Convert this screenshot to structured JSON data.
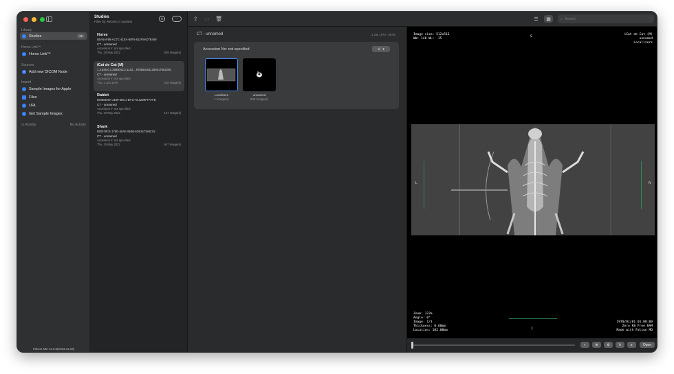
{
  "sidebar": {
    "sections": {
      "library": "Library",
      "horos": "Horos Link™",
      "sources": "Sources",
      "import": "Import"
    },
    "items": {
      "studies": "Studies",
      "studies_count": "16",
      "horos_link": "Horos Link™",
      "add_dicom_node": "Add new DICOM Node",
      "sample_apple": "Sample Images for Apple",
      "files": "Files",
      "url": "URL",
      "get_samples": "Get Sample Images"
    },
    "activity_label": "Activity",
    "activity_status": "No Activity",
    "footer": "Falcon MD v4.0.0(2023.11.23)"
  },
  "studies": {
    "title": "Studies",
    "filter": "Filter by: Recent (4 studies)",
    "list": [
      {
        "name": "Horse",
        "uid": "5BA5AF88-AC7C-41EA-80F5-812F8AD7B459",
        "modality": "CT -   unnamed",
        "accession": "Accession #: not specified",
        "date": "Thu, 19 May 2022",
        "count": "928 image(s)"
      },
      {
        "name": "iCat de Cat (M)",
        "uid": "1.2.826.0.1.3680043.2.1143....9785581811366017562205",
        "modality": "CT -   unnamed",
        "accession": "Accession #: not specified",
        "date": "Thu, 1 Jan 1970",
        "count": "210 image(s)"
      },
      {
        "name": "Rabbit",
        "uid": "5D9EB06A-3189-4BC1-BF17-0112B9FFA7FB",
        "modality": "CT -   unnamed",
        "accession": "Accession #: not specified",
        "date": "Thu, 19 May 2022",
        "count": "147 image(s)"
      },
      {
        "name": "Shark",
        "uid": "850079CE-176D-46AE-864B-6D6157386C52",
        "modality": "CT -   unnamed",
        "accession": "Accession #: not specified",
        "date": "Thu, 19 May 2022",
        "count": "557 image(s)"
      }
    ]
  },
  "toolbar": {
    "search_placeholder": "Search"
  },
  "series_panel": {
    "title": "CT - unnamed",
    "date": "1 Jan 1970 - 00:00",
    "accession": "Accession No: not specified",
    "thumbnails": [
      {
        "label": "Localizers",
        "count": "1 image(s)"
      },
      {
        "label": "unnamed",
        "count": "209 image(s)"
      }
    ]
  },
  "viewer": {
    "top_left": "Image size: 512x513\nWW: 148 WL: -15",
    "top_center": "S",
    "top_right": "iCat de Cat (M)\nunnamed\nLocalizers",
    "left_marker": "L",
    "right_marker": "R",
    "bottom_center": "I",
    "bottom_left": "Zoom: 323%\nAngle: 0°\nImage: 1/1\nThickness: 0.60mm\nLocation: 102.00mm",
    "bottom_right": "1970/01/01 01:00:00\nZero K8 Free RAM\nMade with Falcon MD",
    "open_label": "Open"
  }
}
